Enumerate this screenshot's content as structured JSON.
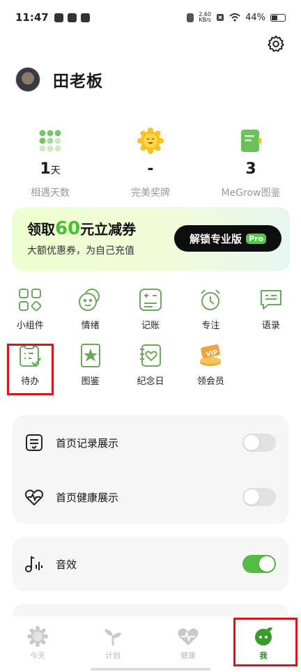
{
  "status_bar": {
    "time": "11:47",
    "net_speed_value": "2.60",
    "net_speed_unit": "KB/s",
    "battery": "44%"
  },
  "profile": {
    "name": "田老板"
  },
  "stats": [
    {
      "value": "1",
      "unit": "天",
      "label": "相遇天数",
      "icon": "grid-dots-icon"
    },
    {
      "value": "-",
      "unit": "",
      "label": "完美奖牌",
      "icon": "sun-medal-icon"
    },
    {
      "value": "3",
      "unit": "",
      "label": "MeGrow图鉴",
      "icon": "book-icon"
    }
  ],
  "promo": {
    "title_prefix": "领取",
    "title_amount": "60",
    "title_suffix": "元立减券",
    "subtitle": "大额优惠券，为自己充值",
    "button_label": "解锁专业版",
    "button_badge": "Pro"
  },
  "features": [
    {
      "label": "小组件",
      "icon": "widgets-icon"
    },
    {
      "label": "情绪",
      "icon": "emotion-icon"
    },
    {
      "label": "记账",
      "icon": "accounting-icon"
    },
    {
      "label": "专注",
      "icon": "focus-clock-icon"
    },
    {
      "label": "语录",
      "icon": "quote-icon"
    },
    {
      "label": "待办",
      "icon": "todo-icon"
    },
    {
      "label": "图鉴",
      "icon": "collection-icon"
    },
    {
      "label": "纪念日",
      "icon": "anniversary-icon"
    },
    {
      "label": "领会员",
      "icon": "vip-icon"
    }
  ],
  "settings": {
    "home_record": {
      "label": "首页记录展示",
      "enabled": false
    },
    "home_health": {
      "label": "首页健康展示",
      "enabled": false
    },
    "sound": {
      "label": "音效",
      "enabled": true
    }
  },
  "tabs": [
    {
      "label": "今天",
      "icon": "sun-icon",
      "active": false
    },
    {
      "label": "计划",
      "icon": "sprout-icon",
      "active": false
    },
    {
      "label": "健康",
      "icon": "heart-pulse-icon",
      "active": false
    },
    {
      "label": "我",
      "icon": "me-icon",
      "active": true
    }
  ],
  "colors": {
    "accent_green": "#54bb45",
    "highlight_red": "#e0101a"
  }
}
